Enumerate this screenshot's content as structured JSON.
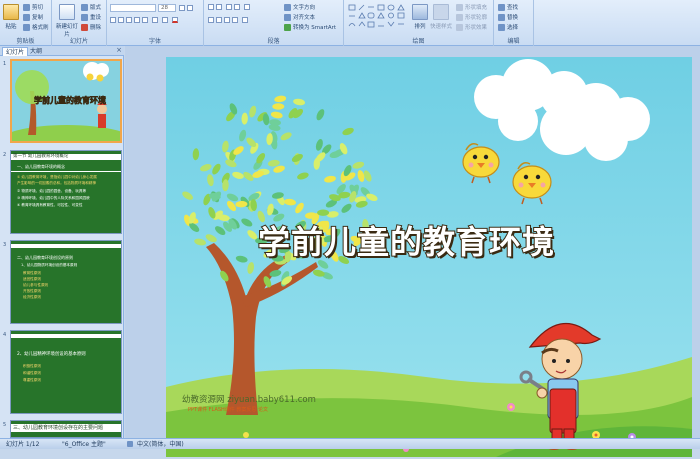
{
  "ribbon": {
    "clipboard": {
      "paste": "粘贴",
      "cut": "剪切",
      "copy": "复制",
      "format_painter": "格式刷",
      "label": "剪贴板"
    },
    "slides": {
      "new_slide": "新建幻灯片",
      "layout": "版式",
      "reset": "重设",
      "delete": "删除",
      "label": "幻灯片"
    },
    "font": {
      "size": "28",
      "label": "字体"
    },
    "paragraph": {
      "text_direction": "文字方向",
      "align_text": "对齐文本",
      "smartart": "转换为 SmartArt",
      "label": "段落"
    },
    "drawing": {
      "arrange": "排列",
      "quick_styles": "快速样式",
      "shape_fill": "形状填充",
      "shape_outline": "形状轮廓",
      "shape_effects": "形状效果",
      "label": "绘图"
    },
    "editing": {
      "find": "查找",
      "replace": "替换",
      "select": "选择",
      "label": "编辑"
    }
  },
  "panel": {
    "tab_slides": "幻灯片",
    "tab_outline": "大纲",
    "close": "×",
    "thumbs": [
      {
        "num": "1",
        "title": "学前儿童的教育环境"
      },
      {
        "num": "2",
        "head": "第一节  幼儿园教育环境概论",
        "sub": "一、幼儿园教育环境的概念",
        "lines": [
          "① 幼儿园教育环境，是指幼儿园中对幼儿身心发展",
          "产生影响的一切因素的总和。包括物质环境和精神",
          "② 物质环境，幼儿园的园舍、设备、玩具等",
          "③ 精神环境，幼儿园中的人际关系和园风园貌",
          "④ 教育环境具有教育性、可控性、可变性"
        ]
      },
      {
        "num": "3",
        "sub": "二、幼儿园教育环境创设的原则",
        "sub2": "1、幼儿园物质环境创设的基本原则",
        "lines": [
          "教育性原则",
          "适宜性原则",
          "幼儿参与性原则",
          "开放性原则",
          "经济性原则"
        ]
      },
      {
        "num": "4",
        "sub": "2、幼儿园精神环境创设的基本原则",
        "lines": [
          "积极性原则",
          "和谐性原则",
          "尊重性原则"
        ]
      },
      {
        "num": "5",
        "head": "三、幼儿园教育环境创设存在的主要问题"
      }
    ]
  },
  "slide": {
    "title": "学前儿童的教育环境",
    "watermark": "幼教资源网 ziyuan.baby611.com",
    "watermark_sub": "PPT课件  FLASH课件  教案反思  论文"
  },
  "status": {
    "slide_info": "幻灯片 1/12",
    "theme": "\"6_Office 主题\"",
    "language": "中文(简体，中国)"
  },
  "colors": {
    "ribbon": "#dae6f5",
    "title_text": "#ffffff",
    "title_outline": "#3a2a12",
    "sky": "#80d5e6"
  }
}
